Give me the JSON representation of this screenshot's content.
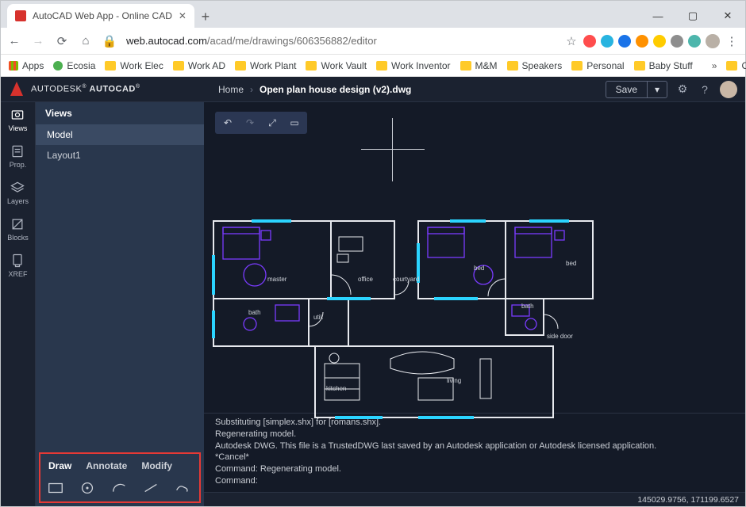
{
  "browser": {
    "tab_title": "AutoCAD Web App - Online CAD",
    "url_host": "web.autocad.com",
    "url_path": "/acad/me/drawings/606356882/editor",
    "bookmarks_toggle_label": "Apps",
    "bookmarks": [
      "Ecosia",
      "Work Elec",
      "Work AD",
      "Work Plant",
      "Work Vault",
      "Work Inventor",
      "M&M",
      "Speakers",
      "Personal",
      "Baby Stuff"
    ],
    "other_bookmarks": "Other bookmarks",
    "extension_colors": [
      "#ff4d4d",
      "#28b4e0",
      "#1a73e8",
      "#ff9100",
      "#ffcc00",
      "#8e8e8e",
      "#4db6ac"
    ]
  },
  "app": {
    "brand_prefix": "AUTODESK",
    "brand_name": "AUTOCAD",
    "breadcrumb_home": "Home",
    "breadcrumb_current": "Open plan house design (v2).dwg",
    "save_label": "Save"
  },
  "rail": {
    "items": [
      "Views",
      "Prop.",
      "Layers",
      "Blocks",
      "XREF"
    ],
    "active_index": 0
  },
  "side": {
    "title": "Views",
    "items": [
      "Model",
      "Layout1"
    ],
    "selected_index": 0
  },
  "tool_tabs": {
    "tabs": [
      "Draw",
      "Annotate",
      "Modify"
    ],
    "active_index": 0,
    "tools": [
      "rectangle",
      "circle",
      "arc",
      "line",
      "revcloud"
    ]
  },
  "plan_labels": {
    "master": "master",
    "office": "office",
    "courtyard": "courtyard",
    "bed1": "bed",
    "bed2": "bed",
    "bath1": "bath",
    "bath2": "bath",
    "util": "util.",
    "kitchen": "kitchen",
    "living": "living",
    "sidedoor": "side door"
  },
  "command_log": [
    "Substituting [simplex.shx] for [romans.shx].",
    "Regenerating model.",
    "Autodesk DWG. This file is a TrustedDWG last saved by an Autodesk application or Autodesk licensed application.",
    "*Cancel*",
    "Command: Regenerating model."
  ],
  "command_prompt": "Command:",
  "status_coords": "145029.9756, 171199.6527"
}
